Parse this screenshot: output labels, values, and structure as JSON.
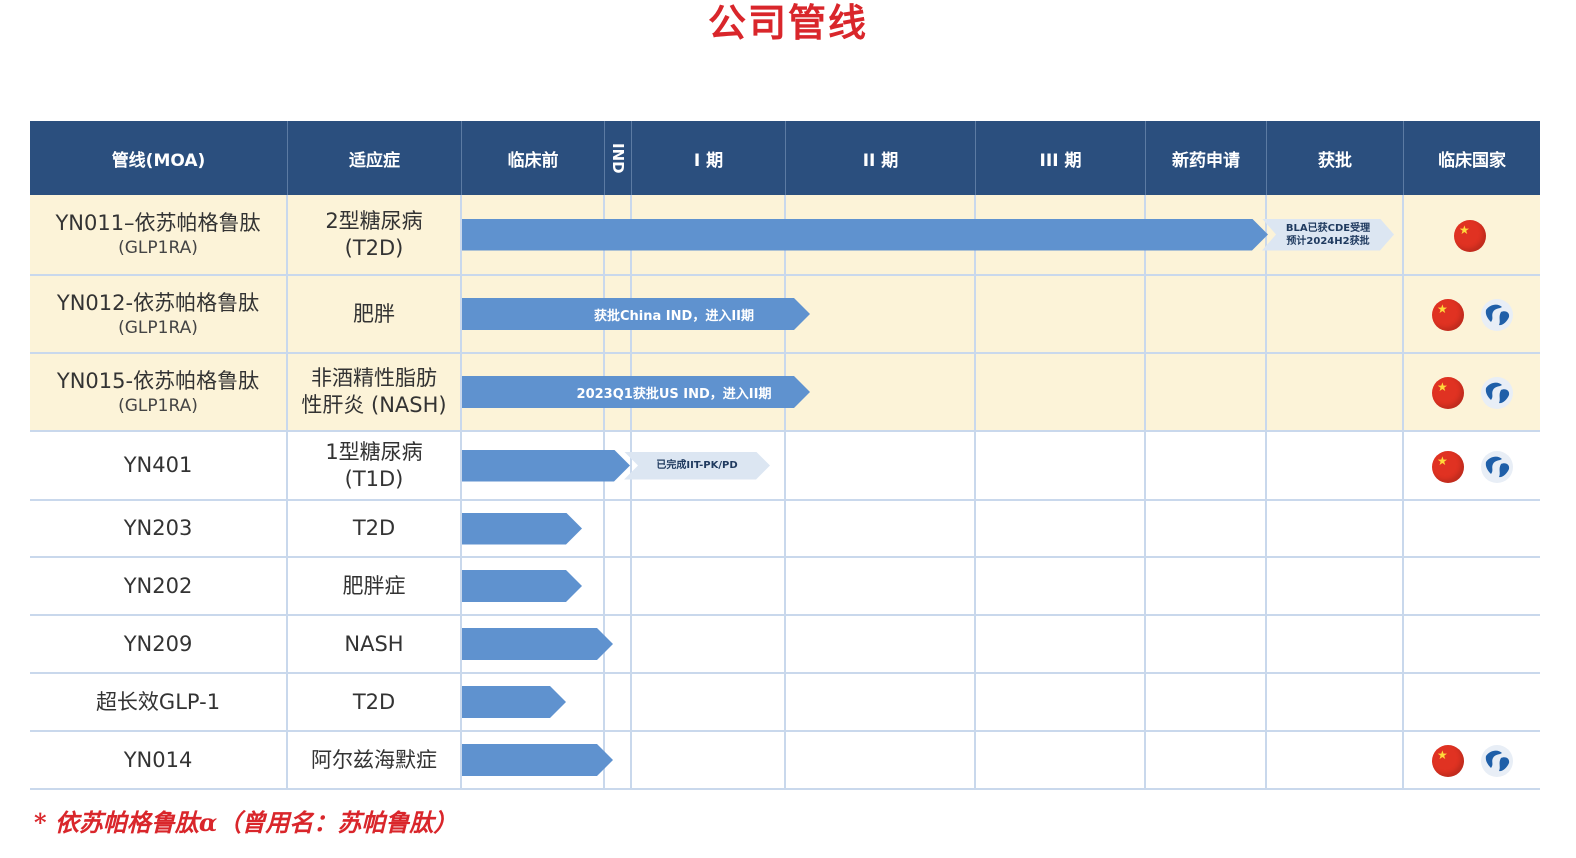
{
  "title": "公司管线",
  "headers": {
    "pipeline": "管线(MOA)",
    "indication": "适应症",
    "preclinical": "临床前",
    "ind": "IND",
    "phase1": "I 期",
    "phase2": "II 期",
    "phase3": "III 期",
    "nda": "新药申请",
    "approved": "获批",
    "countries": "临床国家"
  },
  "rows": [
    {
      "name": "YN011–依苏帕格鲁肽",
      "moa": "(GLP1RA)",
      "ind1": "2型糖尿病",
      "ind2": "(T2D)",
      "note": "BLA已获CDE受理",
      "note2": "预计2024H2获批",
      "progress_stage": "nda_complete",
      "countries": [
        "china"
      ]
    },
    {
      "name": "YN012-依苏帕格鲁肽",
      "moa": "(GLP1RA)",
      "ind1": "肥胖",
      "ind2": "",
      "arrow_text": "获批China IND，进入II期",
      "progress_stage": "phase1_complete",
      "countries": [
        "china",
        "global"
      ]
    },
    {
      "name": "YN015-依苏帕格鲁肽",
      "moa": "(GLP1RA)",
      "ind1": "非酒精性脂肪",
      "ind2": "性肝炎 (NASH)",
      "arrow_text": "2023Q1获批US IND，进入II期",
      "progress_stage": "phase1_complete",
      "countries": [
        "china",
        "global"
      ]
    },
    {
      "name": "YN401",
      "moa": "",
      "ind1": "1型糖尿病",
      "ind2": "(T1D)",
      "note": "已完成IIT-PK/PD",
      "progress_stage": "ind",
      "countries": [
        "china",
        "global"
      ]
    },
    {
      "name": "YN203",
      "moa": "",
      "ind1": "T2D",
      "ind2": "",
      "progress_stage": "preclinical",
      "countries": []
    },
    {
      "name": "YN202",
      "moa": "",
      "ind1": "肥胖症",
      "ind2": "",
      "progress_stage": "preclinical",
      "countries": []
    },
    {
      "name": "YN209",
      "moa": "",
      "ind1": "NASH",
      "ind2": "",
      "progress_stage": "preclinical",
      "countries": []
    },
    {
      "name": "超长效GLP-1",
      "moa": "",
      "ind1": "T2D",
      "ind2": "",
      "progress_stage": "preclinical",
      "countries": []
    },
    {
      "name": "YN014",
      "moa": "",
      "ind1": "阿尔兹海默症",
      "ind2": "",
      "progress_stage": "preclinical",
      "countries": [
        "china",
        "global"
      ]
    }
  ],
  "footnote": "* 依苏帕格鲁肽α（曾用名：苏帕鲁肽）",
  "colors": {
    "title": "#d9262b",
    "header_bg": "#2b4f7e",
    "arrow": "#5f92cf",
    "highlight_row": "#fcf3d8"
  }
}
